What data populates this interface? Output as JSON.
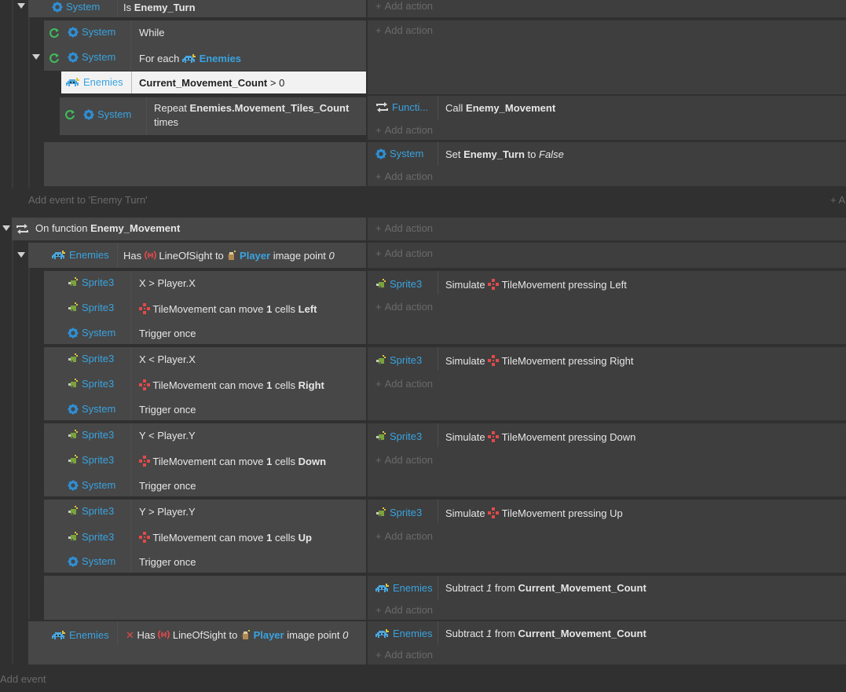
{
  "events": {
    "top_system_label": "System",
    "is_text": "Is",
    "enemy_turn": "Enemy_Turn",
    "while_text": "While",
    "for_each_text": "For each",
    "enemies": "Enemies",
    "system": "System",
    "sprite3": "Sprite3",
    "current_movement_count": "Current_Movement_Count",
    "gt_zero": "> 0",
    "repeat_text": "Repeat",
    "repeat_expr": "Enemies.Movement_Tiles_Count",
    "times_text": "times",
    "functi": "Functi...",
    "call_text": "Call",
    "enemy_movement": "Enemy_Movement",
    "set_text": "Set",
    "to_text": "to",
    "false_text": "False",
    "add_action": "Add action",
    "add_event_enemy_turn": "Add event to 'Enemy Turn'",
    "on_function_text": "On function",
    "has_text": "Has",
    "line_of_sight": "LineOfSight",
    "player": "Player",
    "image_point_text": "image point",
    "zero": "0",
    "x_gt": "X > Player.X",
    "x_lt": "X < Player.X",
    "y_lt": "Y < Player.Y",
    "y_gt": "Y > Player.Y",
    "tile_movement": "TileMovement",
    "can_move_text": "can move",
    "one": "1",
    "cells_text": "cells",
    "left": "Left",
    "right": "Right",
    "down": "Down",
    "up": "Up",
    "trigger_once": "Trigger once",
    "simulate_text": "Simulate",
    "pressing_left": "pressing Left",
    "pressing_right": "pressing Right",
    "pressing_down": "pressing Down",
    "pressing_up": "pressing Up",
    "subtract_text": "Subtract",
    "one_italic": "1",
    "from_text": "from",
    "x_mark": "✕",
    "add_event": "Add event",
    "right_plus": "+ A"
  },
  "icons": [
    "gear-icon",
    "loop-icon",
    "invader-icon",
    "sprite-icon",
    "tile-movement-icon",
    "line-of-sight-icon",
    "function-icon",
    "player-icon",
    "plus-icon"
  ],
  "colors": {
    "object_blue": "#39a3e0",
    "loop_green": "#3fbf5a",
    "tile_red": "#e24a4a",
    "invader_blue": "#4aa8e0"
  }
}
